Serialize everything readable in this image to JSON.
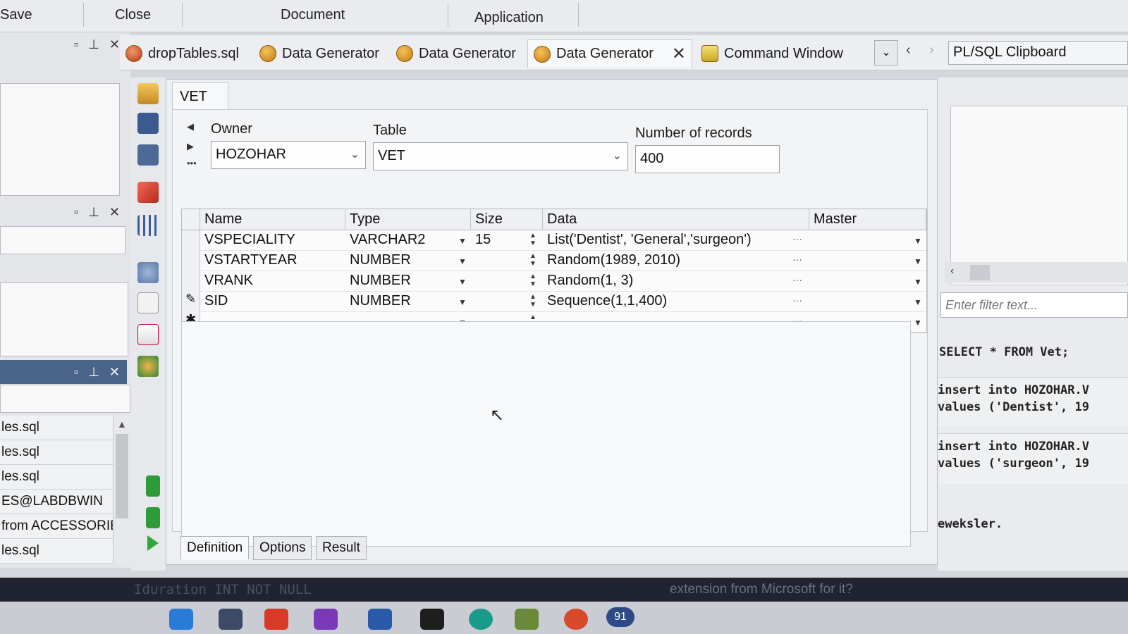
{
  "menu": {
    "save": "Save",
    "close": "Close",
    "document": "Document",
    "application": "Application"
  },
  "tabs": [
    {
      "label": "dropTables.sql"
    },
    {
      "label": "Data Generator"
    },
    {
      "label": "Data Generator"
    },
    {
      "label": "Data Generator",
      "active": true
    },
    {
      "label": "Command Window"
    }
  ],
  "clipboard_label": "PL/SQL Clipboard",
  "panel": {
    "tab_title": "VET",
    "owner_label": "Owner",
    "owner_value": "HOZOHAR",
    "table_label": "Table",
    "table_value": "VET",
    "records_label": "Number of records",
    "records_value": "400"
  },
  "grid": {
    "columns": [
      "Name",
      "Type",
      "Size",
      "Data",
      "Master"
    ],
    "rows": [
      {
        "name": "VSPECIALITY",
        "type": "VARCHAR2",
        "size": "15",
        "data": "List('Dentist', 'General','surgeon')",
        "master": ""
      },
      {
        "name": "VSTARTYEAR",
        "type": "NUMBER",
        "size": "",
        "data": "Random(1989, 2010)",
        "master": ""
      },
      {
        "name": "VRANK",
        "type": "NUMBER",
        "size": "",
        "data": "Random(1, 3)",
        "master": ""
      },
      {
        "name": "SID",
        "type": "NUMBER",
        "size": "",
        "data": "Sequence(1,1,400)",
        "master": ""
      }
    ]
  },
  "bottom_tabs": [
    "Definition",
    "Options",
    "Result"
  ],
  "left_files": [
    "les.sql",
    "les.sql",
    "les.sql",
    "ES@LABDBWIN",
    "from ACCESSORIES",
    "les.sql"
  ],
  "right_panel": {
    "filter_placeholder": "Enter filter text...",
    "sql_lines": [
      "SELECT * FROM Vet;",
      "insert into HOZOHAR.V",
      "values ('Dentist', 19",
      "insert into HOZOHAR.V",
      "values ('surgeon', 19",
      "eweksler."
    ]
  },
  "status": {
    "left": "Iduration INT NOT NULL",
    "right": "extension from Microsoft for it?"
  },
  "taskbar": {
    "badge": "91"
  }
}
